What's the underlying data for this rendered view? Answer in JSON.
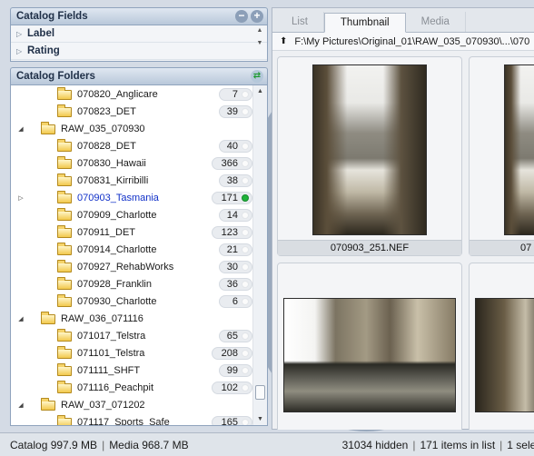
{
  "catalog_fields": {
    "title": "Catalog Fields",
    "items": [
      {
        "label": "Label"
      },
      {
        "label": "Rating"
      }
    ]
  },
  "catalog_folders": {
    "title": "Catalog Folders",
    "rows": [
      {
        "name": "070820_Anglicare",
        "count": "7",
        "level": 2,
        "type": "folder"
      },
      {
        "name": "070823_DET",
        "count": "39",
        "level": 2,
        "type": "folder"
      },
      {
        "name": "RAW_035_070930",
        "count": "",
        "level": 1,
        "type": "open"
      },
      {
        "name": "070828_DET",
        "count": "40",
        "level": 2,
        "type": "folder"
      },
      {
        "name": "070830_Hawaii",
        "count": "366",
        "level": 2,
        "type": "folder"
      },
      {
        "name": "070831_Kirribilli",
        "count": "38",
        "level": 2,
        "type": "folder"
      },
      {
        "name": "070903_Tasmania",
        "count": "171",
        "level": 2,
        "type": "folder",
        "selected": true
      },
      {
        "name": "070909_Charlotte",
        "count": "14",
        "level": 2,
        "type": "folder"
      },
      {
        "name": "070911_DET",
        "count": "123",
        "level": 2,
        "type": "folder"
      },
      {
        "name": "070914_Charlotte",
        "count": "21",
        "level": 2,
        "type": "folder"
      },
      {
        "name": "070927_RehabWorks",
        "count": "30",
        "level": 2,
        "type": "folder"
      },
      {
        "name": "070928_Franklin",
        "count": "36",
        "level": 2,
        "type": "folder"
      },
      {
        "name": "070930_Charlotte",
        "count": "6",
        "level": 2,
        "type": "folder"
      },
      {
        "name": "RAW_036_071116",
        "count": "",
        "level": 1,
        "type": "open"
      },
      {
        "name": "071017_Telstra",
        "count": "65",
        "level": 2,
        "type": "folder"
      },
      {
        "name": "071101_Telstra",
        "count": "208",
        "level": 2,
        "type": "folder"
      },
      {
        "name": "071111_SHFT",
        "count": "99",
        "level": 2,
        "type": "folder"
      },
      {
        "name": "071116_Peachpit",
        "count": "102",
        "level": 2,
        "type": "folder"
      },
      {
        "name": "RAW_037_071202",
        "count": "",
        "level": 1,
        "type": "open"
      },
      {
        "name": "071117_Sports_Safe",
        "count": "165",
        "level": 2,
        "type": "folder"
      }
    ]
  },
  "tabs": [
    {
      "label": "List",
      "active": false
    },
    {
      "label": "Thumbnail",
      "active": true
    },
    {
      "label": "Media",
      "active": false
    }
  ],
  "path": "F:\\My Pictures\\Original_01\\RAW_035_070930\\...\\070",
  "thumbnails": [
    {
      "caption": "070903_251.NEF"
    },
    {
      "caption": "07"
    }
  ],
  "status": {
    "catalog": "Catalog  997.9 MB",
    "media": "Media 968.7 MB",
    "hidden": "31034 hidden",
    "items": "171 items in list",
    "selected": "1 sele"
  },
  "colors": {
    "selected_text": "#1030c8",
    "status_dot_green": "#1fb33a",
    "panel_header": "#b9c8da"
  }
}
